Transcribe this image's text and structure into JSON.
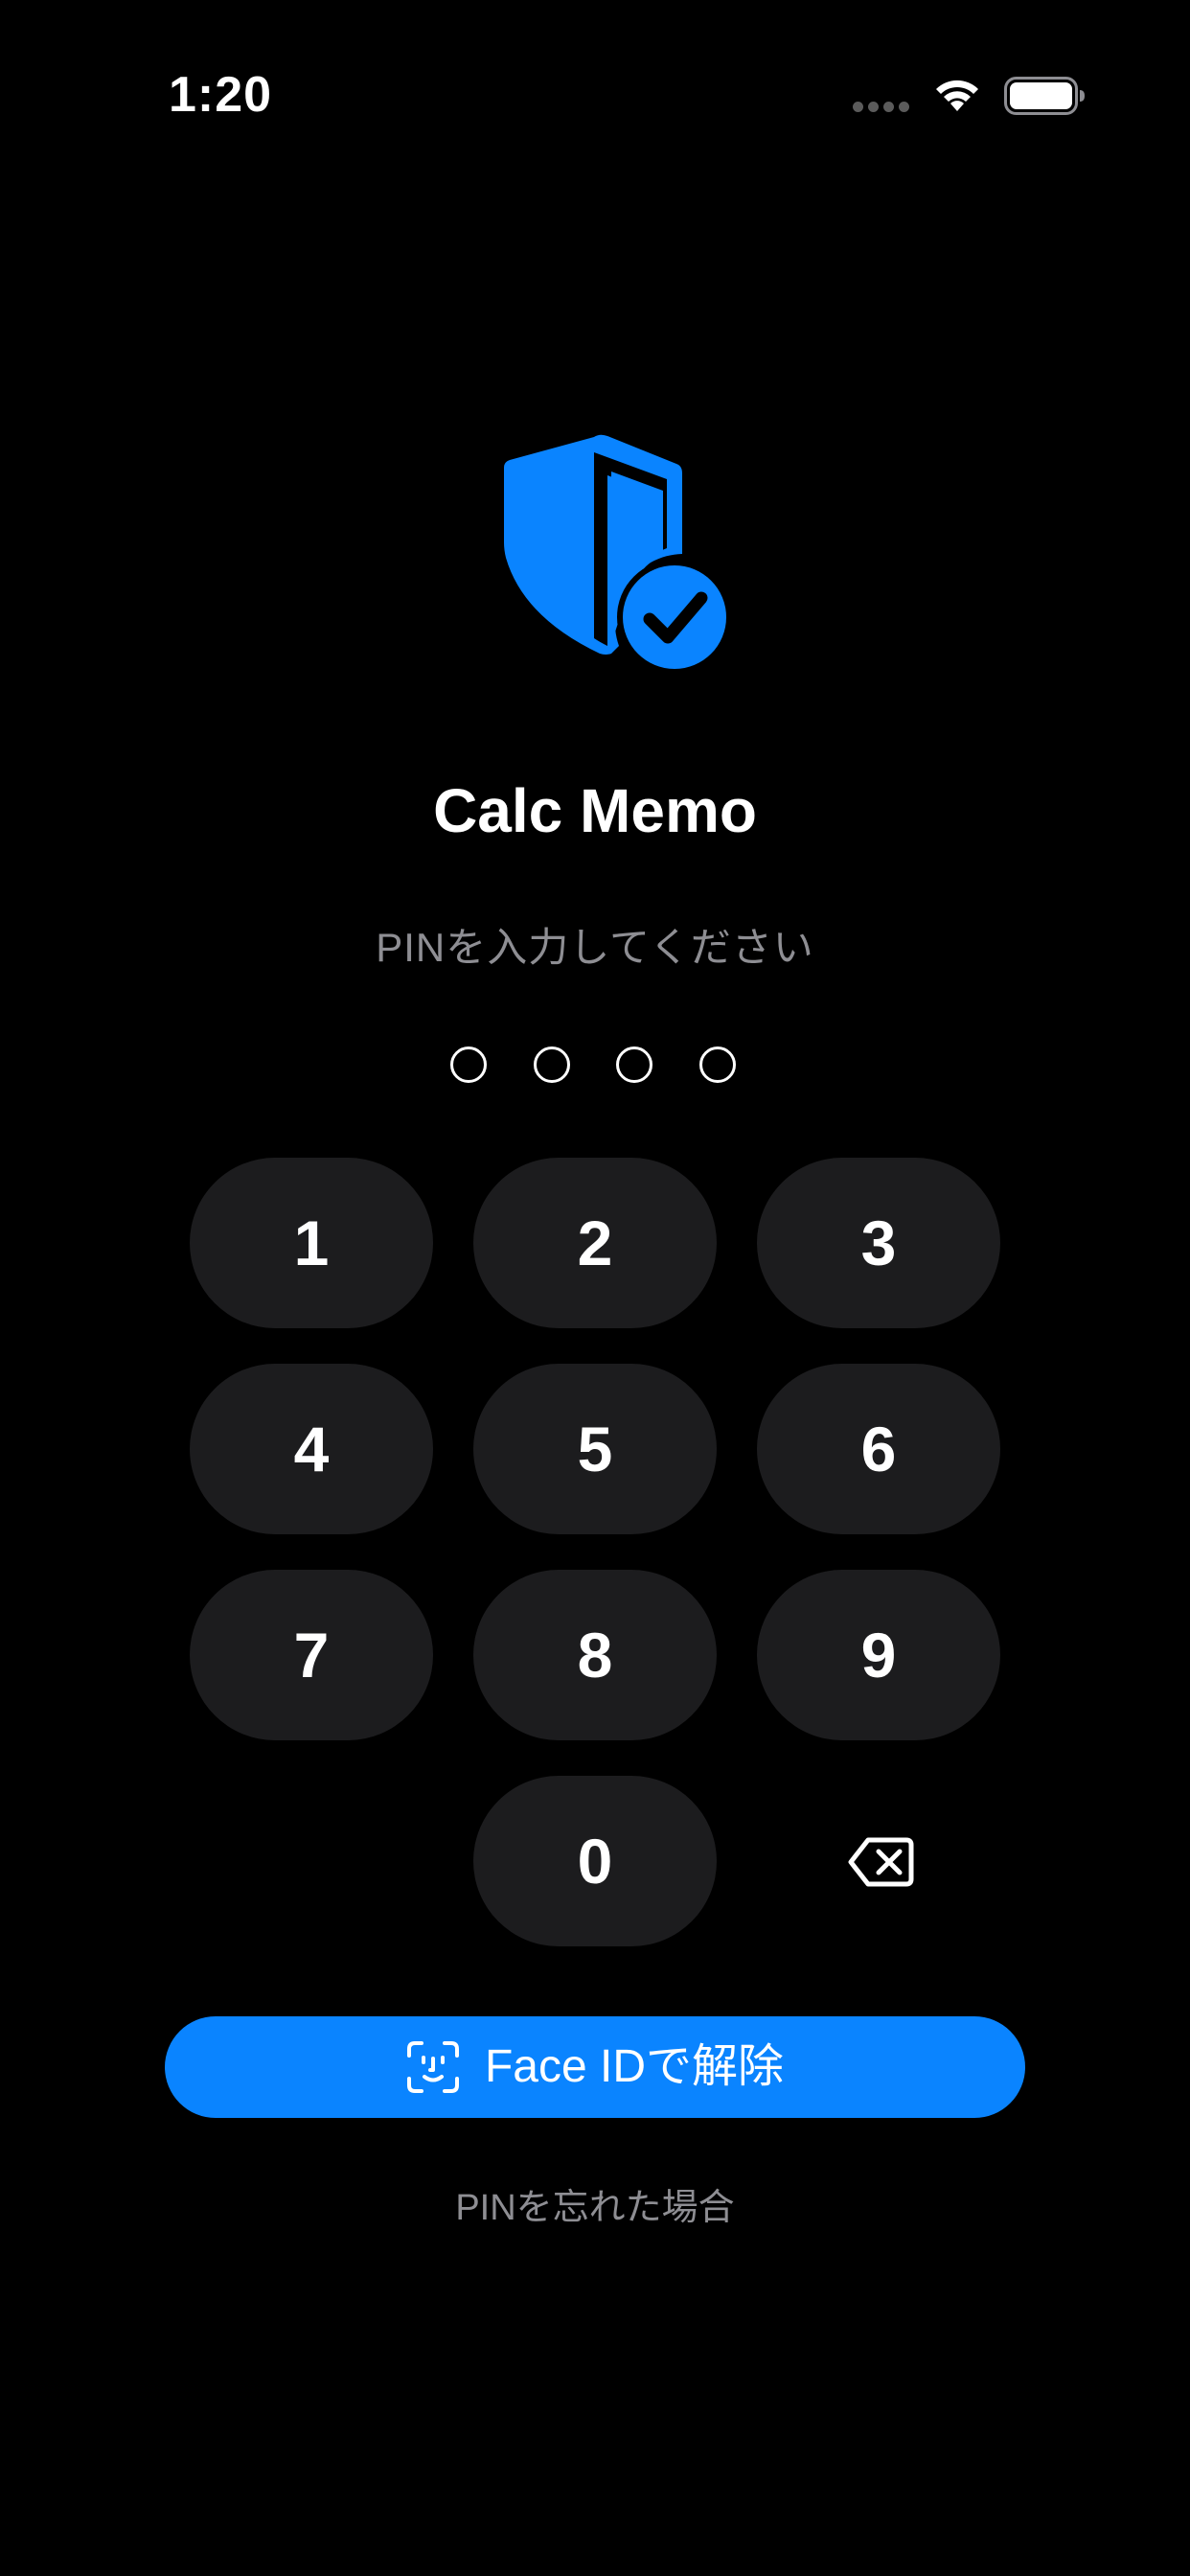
{
  "status_bar": {
    "time": "1:20"
  },
  "app": {
    "title": "Calc Memo",
    "pin_prompt": "PINを入力してください"
  },
  "pin": {
    "length": 4,
    "entered": 0
  },
  "keypad": {
    "keys": [
      "1",
      "2",
      "3",
      "4",
      "5",
      "6",
      "7",
      "8",
      "9",
      "0"
    ]
  },
  "actions": {
    "face_id_label": "Face IDで解除",
    "forgot_pin_label": "PINを忘れた場合"
  },
  "icons": {
    "logo": "shield-check-icon",
    "backspace": "delete-left-icon",
    "face_id": "face-id-icon"
  },
  "colors": {
    "background": "#000000",
    "accent": "#0a84ff",
    "key_background": "#1c1c1e",
    "secondary_text": "#8e8e93"
  }
}
